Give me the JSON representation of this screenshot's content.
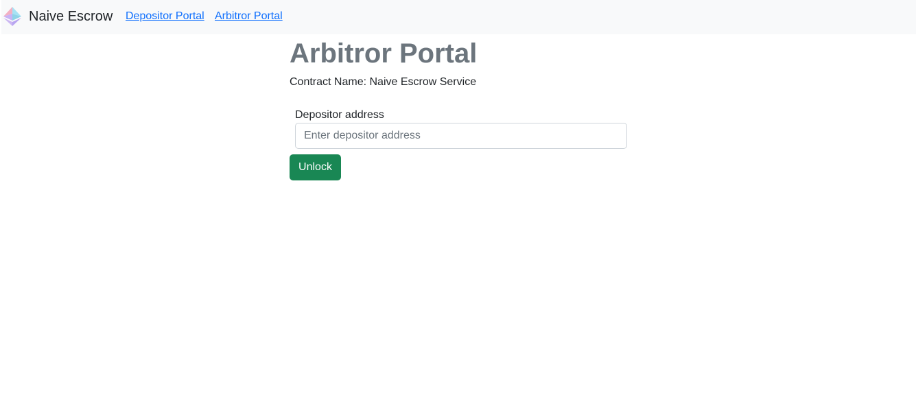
{
  "navbar": {
    "logo_icon": "ethereum-diamond-icon",
    "brand": "Naive Escrow",
    "links": [
      {
        "label": "Depositor Portal"
      },
      {
        "label": "Arbitror Portal"
      }
    ]
  },
  "main": {
    "title": "Arbitror Portal",
    "contract_line": "Contract Name: Naive Escrow Service",
    "depositor_field": {
      "label": "Depositor address",
      "placeholder": "Enter depositor address",
      "value": ""
    },
    "unlock_label": "Unlock"
  },
  "colors": {
    "navbar_bg": "#f8f9fa",
    "link": "#0d6efd",
    "title": "#6c757d",
    "button": "#198754"
  }
}
